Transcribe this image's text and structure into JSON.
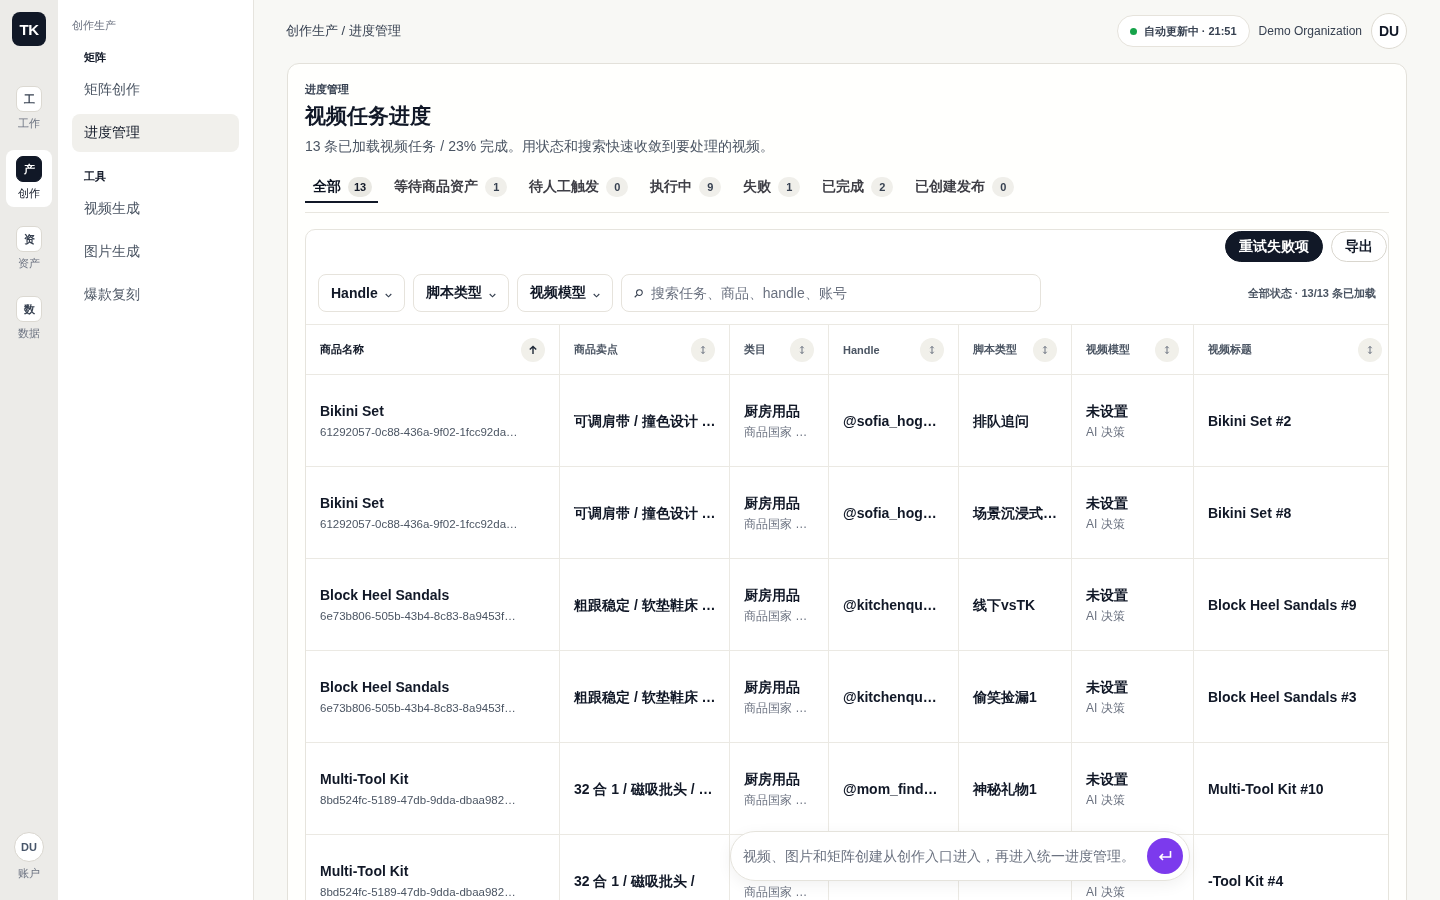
{
  "rail": {
    "logo": "TK",
    "items": [
      {
        "glyph": "工",
        "label": "工作",
        "selected": false
      },
      {
        "glyph": "产",
        "label": "创作",
        "selected": true
      },
      {
        "glyph": "资",
        "label": "资产",
        "selected": false
      },
      {
        "glyph": "数",
        "label": "数据",
        "selected": false
      }
    ],
    "account": {
      "initials": "DU",
      "label": "账户"
    }
  },
  "sidebar": {
    "section": "创作生产",
    "groups": [
      {
        "title": "矩阵",
        "items": [
          {
            "label": "矩阵创作",
            "selected": false
          },
          {
            "label": "进度管理",
            "selected": true
          }
        ]
      },
      {
        "title": "工具",
        "items": [
          {
            "label": "视频生成",
            "selected": false
          },
          {
            "label": "图片生成",
            "selected": false
          },
          {
            "label": "爆款复刻",
            "selected": false
          }
        ]
      }
    ]
  },
  "header": {
    "breadcrumb": "创作生产 / 进度管理",
    "status": {
      "label": "自动更新中 · 21:51",
      "live": true
    },
    "organization": "Demo Organization",
    "avatar": "DU"
  },
  "page": {
    "eyebrow": "进度管理",
    "title": "视频任务进度",
    "subtitle": "13 条已加载视频任务 / 23% 完成。用状态和搜索快速收敛到要处理的视频。"
  },
  "tabs": [
    {
      "label": "全部",
      "count": "13",
      "selected": true
    },
    {
      "label": "等待商品资产",
      "count": "1",
      "selected": false
    },
    {
      "label": "待人工触发",
      "count": "0",
      "selected": false
    },
    {
      "label": "执行中",
      "count": "9",
      "selected": false
    },
    {
      "label": "失败",
      "count": "1",
      "selected": false
    },
    {
      "label": "已完成",
      "count": "2",
      "selected": false
    },
    {
      "label": "已创建发布",
      "count": "0",
      "selected": false
    }
  ],
  "actions": [
    {
      "label": "重试失败项",
      "kind": "primary"
    },
    {
      "label": "导出",
      "kind": "secondary"
    }
  ],
  "filters": [
    "Handle",
    "脚本类型",
    "视频模型"
  ],
  "search": {
    "placeholder": "搜索任务、商品、handle、账号"
  },
  "load_summary": "全部状态 · 13/13 条已加载",
  "table": {
    "columns": [
      {
        "label": "商品名称",
        "sorted": true
      },
      {
        "label": "商品卖点",
        "sorted": false
      },
      {
        "label": "类目",
        "sorted": false
      },
      {
        "label": "Handle",
        "sorted": false
      },
      {
        "label": "脚本类型",
        "sorted": false
      },
      {
        "label": "视频模型",
        "sorted": false
      },
      {
        "label": "视频标题",
        "sorted": false
      }
    ],
    "rows": [
      {
        "product": "Bikini Set",
        "task_id": "61292057-0c88-436a-9f02-1fcc92da…",
        "selling_point": "可调肩带 / 撞色设计 …",
        "category": "厨房用品",
        "category_note": "商品国家 …",
        "handle": "@sofia_hog…",
        "script_type": "排队追问",
        "model": "未设置",
        "model_note": "AI 决策",
        "title": "Bikini Set #2"
      },
      {
        "product": "Bikini Set",
        "task_id": "61292057-0c88-436a-9f02-1fcc92da…",
        "selling_point": "可调肩带 / 撞色设计 …",
        "category": "厨房用品",
        "category_note": "商品国家 …",
        "handle": "@sofia_hog…",
        "script_type": "场景沉浸式…",
        "model": "未设置",
        "model_note": "AI 决策",
        "title": "Bikini Set #8"
      },
      {
        "product": "Block Heel Sandals",
        "task_id": "6e73b806-505b-43b4-8c83-8a9453f…",
        "selling_point": "粗跟稳定 / 软垫鞋床 …",
        "category": "厨房用品",
        "category_note": "商品国家 …",
        "handle": "@kitchenqu…",
        "script_type": "线下vsTK",
        "model": "未设置",
        "model_note": "AI 决策",
        "title": "Block Heel Sandals #9"
      },
      {
        "product": "Block Heel Sandals",
        "task_id": "6e73b806-505b-43b4-8c83-8a9453f…",
        "selling_point": "粗跟稳定 / 软垫鞋床 …",
        "category": "厨房用品",
        "category_note": "商品国家 …",
        "handle": "@kitchenqu…",
        "script_type": "偷笑捡漏1",
        "model": "未设置",
        "model_note": "AI 决策",
        "title": "Block Heel Sandals #3"
      },
      {
        "product": "Multi-Tool Kit",
        "task_id": "8bd524fc-5189-47db-9dda-dbaa982…",
        "selling_point": "32 合 1 / 磁吸批头 / …",
        "category": "厨房用品",
        "category_note": "商品国家 …",
        "handle": "@mom_find…",
        "script_type": "神秘礼物1",
        "model": "未设置",
        "model_note": "AI 决策",
        "title": "Multi-Tool Kit #10"
      },
      {
        "product": "Multi-Tool Kit",
        "task_id": "8bd524fc-5189-47db-9dda-dbaa982…",
        "selling_point": "32 合 1 / 磁吸批头 /",
        "category_note": "商品国家 …",
        "model_note": "AI 决策",
        "title": "-Tool Kit #4"
      }
    ]
  },
  "composer": {
    "placeholder": "视频、图片和矩阵创建从创作入口进入，再进入统一进度管理。"
  }
}
